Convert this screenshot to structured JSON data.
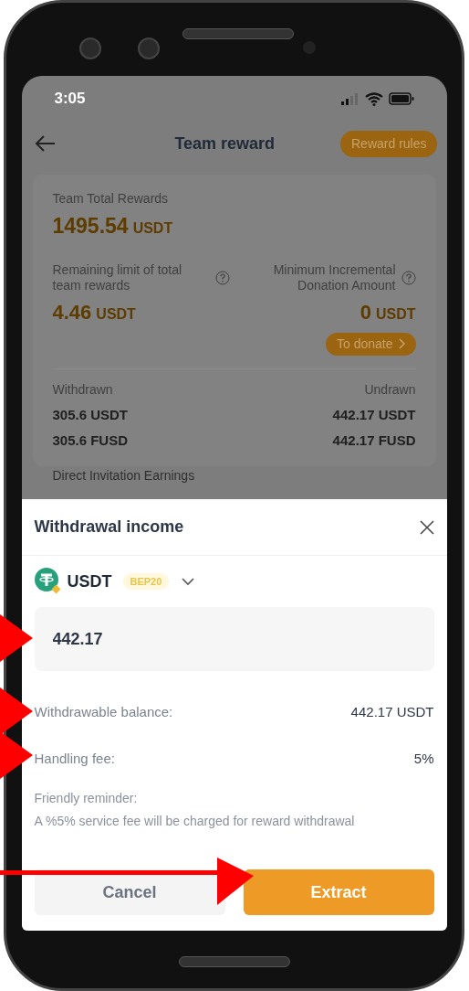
{
  "status_bar": {
    "time": "3:05"
  },
  "header": {
    "title": "Team reward",
    "rules_button": "Reward rules"
  },
  "summary": {
    "total_label": "Team Total Rewards",
    "total_value": "1495.54",
    "total_unit": "USDT",
    "remaining_label": "Remaining limit of total team rewards",
    "remaining_value": "4.46",
    "remaining_unit": "USDT",
    "minimum_label": "Minimum Incremental Donation Amount",
    "minimum_value": "0",
    "minimum_unit": "USDT",
    "donate_button": "To donate",
    "withdrawn_label": "Withdrawn",
    "undrawn_label": "Undrawn",
    "withdrawn": [
      "305.6 USDT",
      "305.6 FUSD"
    ],
    "undrawn": [
      "442.17 USDT",
      "442.17 FUSD"
    ]
  },
  "section_title": "Direct Invitation Earnings",
  "sheet": {
    "title": "Withdrawal income",
    "token": "USDT",
    "network": "BEP20",
    "amount_value": "442.17",
    "rows": [
      {
        "label": "Withdrawable balance:",
        "value": "442.17 USDT"
      },
      {
        "label": "Handling fee:",
        "value": "5%"
      }
    ],
    "reminder_title": "Friendly reminder:",
    "reminder_text": "A %5% service fee will be charged for reward withdrawal",
    "buttons": [
      {
        "label": "Cancel",
        "kind": "secondary"
      },
      {
        "label": "Extract",
        "kind": "primary"
      }
    ]
  }
}
